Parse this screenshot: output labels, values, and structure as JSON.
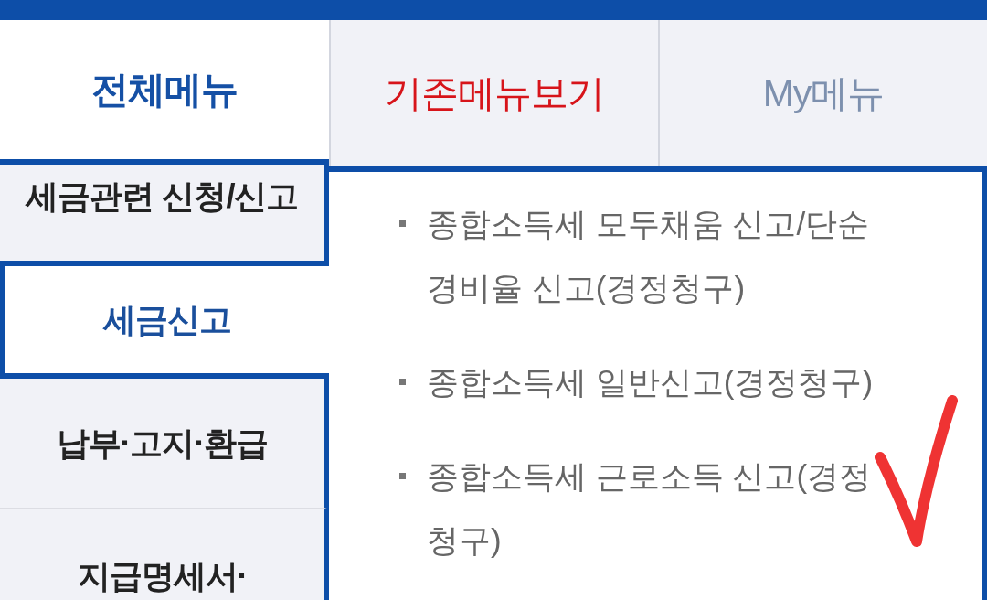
{
  "tabs": [
    {
      "label": "전체메뉴",
      "selected": true,
      "highlighted": false
    },
    {
      "label": "기존메뉴보기",
      "selected": false,
      "highlighted": true
    },
    {
      "label": "My메뉴",
      "selected": false,
      "highlighted": false
    }
  ],
  "sidebar": {
    "items": [
      {
        "label": "세금관련 신청/신고",
        "selected": false
      },
      {
        "label": "세금신고",
        "selected": true
      },
      {
        "label": "납부·고지·환급",
        "selected": false
      },
      {
        "label": "지급명세서·",
        "selected": false
      }
    ]
  },
  "submenu": {
    "items": [
      "종합소득세 모두채움 신고/단순 경비율 신고(경정청구)",
      "종합소득세 일반신고(경정청구)",
      "종합소득세 근로소득 신고(경정청구)"
    ]
  }
}
